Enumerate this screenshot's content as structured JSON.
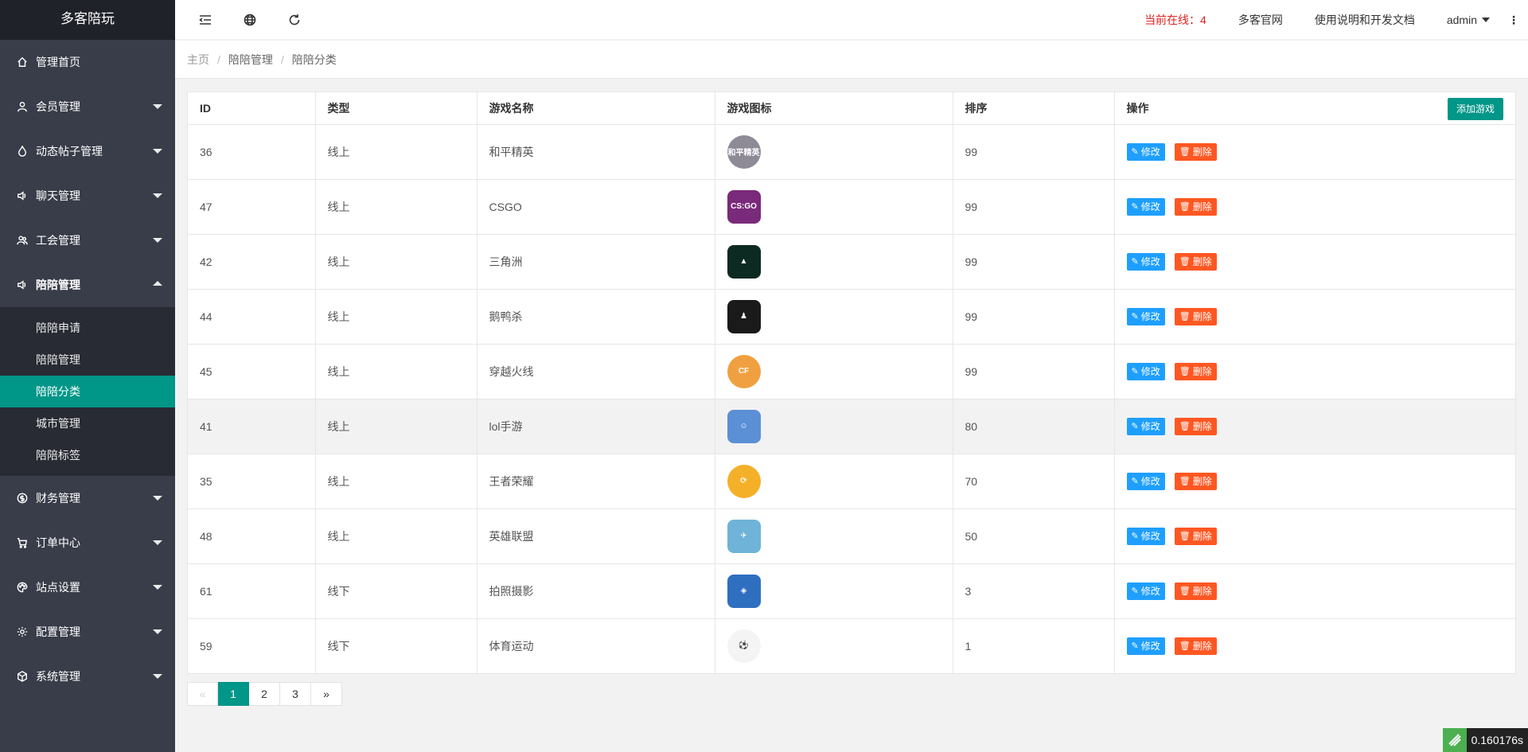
{
  "sidebar": {
    "logo": "多客陪玩",
    "items": [
      {
        "label": "管理首页",
        "icon": "home-icon"
      },
      {
        "label": "会员管理",
        "icon": "user-icon"
      },
      {
        "label": "动态帖子管理",
        "icon": "fire-icon"
      },
      {
        "label": "聊天管理",
        "icon": "speaker-icon"
      },
      {
        "label": "工会管理",
        "icon": "group-icon"
      },
      {
        "label": "陪陪管理",
        "icon": "speaker-icon"
      }
    ],
    "sub_items": [
      {
        "label": "陪陪申请"
      },
      {
        "label": "陪陪管理"
      },
      {
        "label": "陪陪分类"
      },
      {
        "label": "城市管理"
      },
      {
        "label": "陪陪标签"
      }
    ],
    "items_after": [
      {
        "label": "财务管理",
        "icon": "dollar-icon"
      },
      {
        "label": "订单中心",
        "icon": "cart-icon"
      },
      {
        "label": "站点设置",
        "icon": "palette-icon"
      },
      {
        "label": "配置管理",
        "icon": "gear-icon"
      },
      {
        "label": "系统管理",
        "icon": "cube-icon"
      }
    ]
  },
  "header": {
    "online_text": "当前在线：4",
    "link_site": "多客官网",
    "link_docs": "使用说明和开发文档",
    "user": "admin",
    "more": "⋮"
  },
  "breadcrumb": [
    "主页",
    "陪陪管理",
    "陪陪分类"
  ],
  "table": {
    "columns": [
      "ID",
      "类型",
      "游戏名称",
      "游戏图标",
      "排序",
      "操作"
    ],
    "add_button": "添加游戏",
    "edit_label": "修改",
    "delete_label": "删除",
    "rows": [
      {
        "id": "36",
        "type": "线上",
        "name": "和平精英",
        "sort": "99",
        "icon_color": "#8e8a96",
        "icon_text": "和平精英"
      },
      {
        "id": "47",
        "type": "线上",
        "name": "CSGO",
        "sort": "99",
        "icon_color": "#7a2a7a",
        "icon_text": "CS:GO"
      },
      {
        "id": "42",
        "type": "线上",
        "name": "三角洲",
        "sort": "99",
        "icon_color": "#0d2a22",
        "icon_text": "▲"
      },
      {
        "id": "44",
        "type": "线上",
        "name": "鹅鸭杀",
        "sort": "99",
        "icon_color": "#1a1a1a",
        "icon_text": "♟"
      },
      {
        "id": "45",
        "type": "线上",
        "name": "穿越火线",
        "sort": "99",
        "icon_color": "#f0a040",
        "icon_text": "CF"
      },
      {
        "id": "41",
        "type": "线上",
        "name": "lol手游",
        "sort": "80",
        "icon_color": "#5b8fd6",
        "icon_text": "☺"
      },
      {
        "id": "35",
        "type": "线上",
        "name": "王者荣耀",
        "sort": "70",
        "icon_color": "#f5b02a",
        "icon_text": "⟳"
      },
      {
        "id": "48",
        "type": "线上",
        "name": "英雄联盟",
        "sort": "50",
        "icon_color": "#6fb3d8",
        "icon_text": "✈"
      },
      {
        "id": "61",
        "type": "线下",
        "name": "拍照摄影",
        "sort": "3",
        "icon_color": "#2f6fc0",
        "icon_text": "◈"
      },
      {
        "id": "59",
        "type": "线下",
        "name": "体育运动",
        "sort": "1",
        "icon_color": "#f4f4f4",
        "icon_text": "⚽"
      }
    ]
  },
  "pagination": {
    "prev": "«",
    "pages": [
      "1",
      "2",
      "3"
    ],
    "next": "»",
    "current": "1"
  },
  "trace": {
    "time": "0.160176s"
  }
}
